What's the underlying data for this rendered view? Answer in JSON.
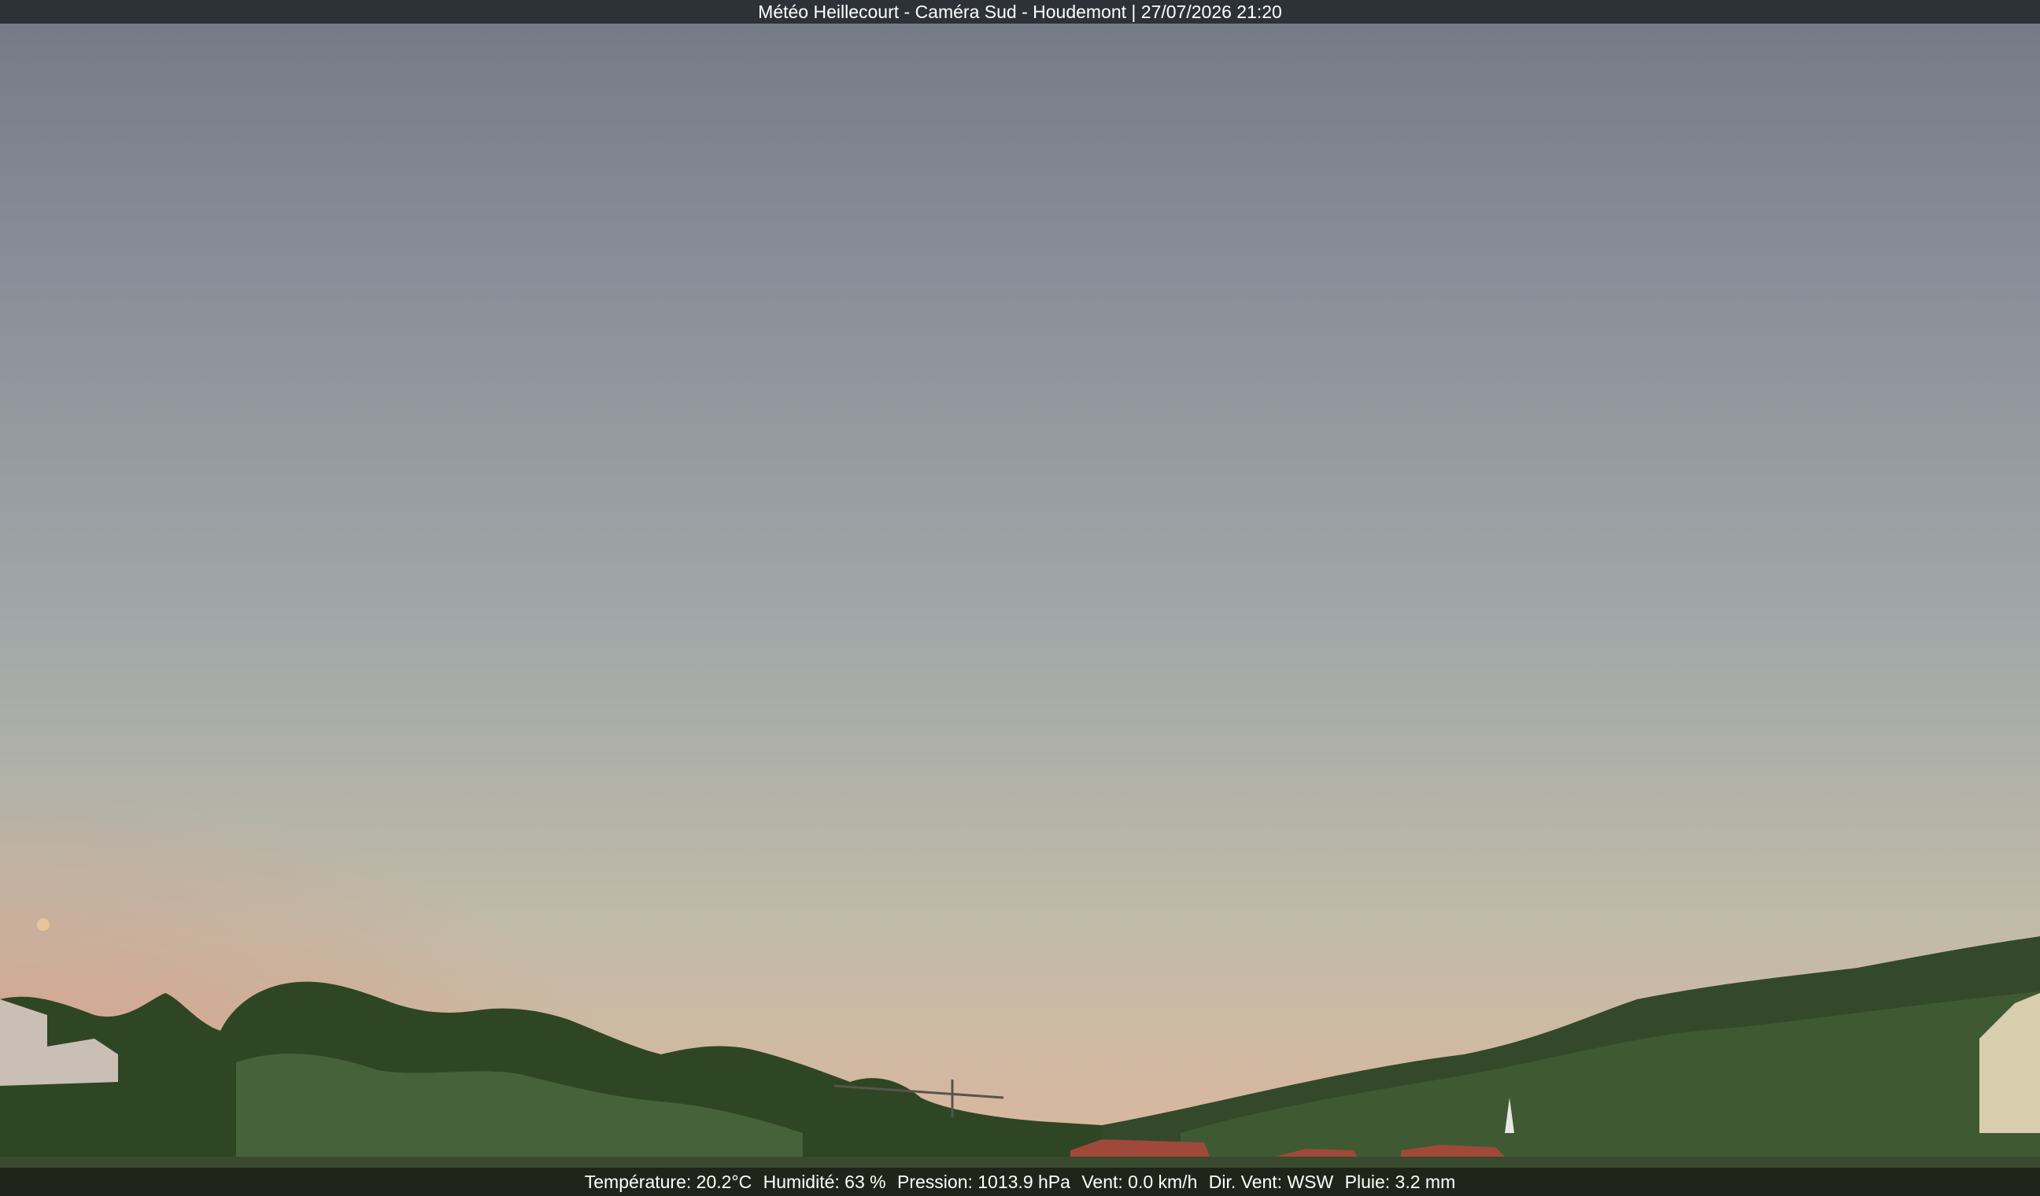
{
  "overlay_top": {
    "caption": "Météo Heillecourt - Caméra Sud - Houdemont | 27/07/2026 21:20"
  },
  "overlay_bottom": {
    "temperature": "Température: 20.2°C",
    "humidity": "Humidité: 63 %",
    "pressure": "Pression: 1013.9 hPa",
    "wind": "Vent: 0.0 km/h",
    "wind_dir": "Dir. Vent: WSW",
    "rain": "Pluie: 3.2 mm"
  },
  "scene": {
    "sky_colors": [
      "#767c86",
      "#8c949b",
      "#a8adaa",
      "#c4bba9",
      "#d8b79e"
    ],
    "foliage_colors": [
      "#2d4322",
      "#3b5530",
      "#4a6338"
    ],
    "roof_color": "#a0493a",
    "moon_color": "#e8c49a"
  }
}
